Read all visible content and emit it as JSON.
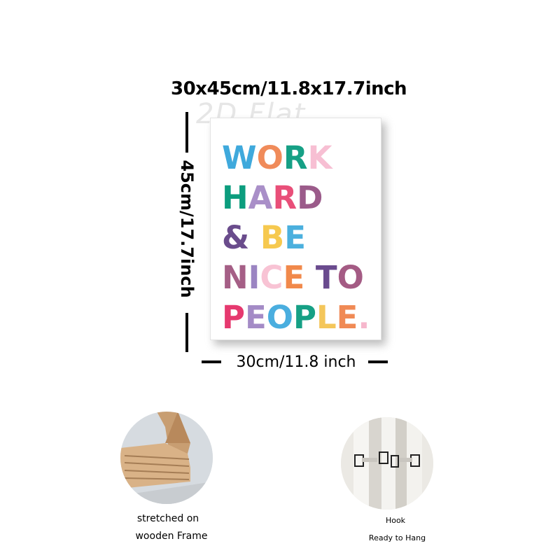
{
  "dimensions": {
    "top_label": "30x45cm/11.8x17.7inch",
    "left_label": "45cm/17.7inch",
    "bottom_label": "30cm/11.8 inch"
  },
  "watermark": "2D Flat",
  "poster": {
    "lines": [
      [
        {
          "text": "W",
          "color": "#3fa9dc"
        },
        {
          "text": "O",
          "color": "#f08b5a"
        },
        {
          "text": "R",
          "color": "#16a085"
        },
        {
          "text": "K",
          "color": "#f7bfd3"
        }
      ],
      [
        {
          "text": "H",
          "color": "#0c9d7e"
        },
        {
          "text": "A",
          "color": "#a98fc8"
        },
        {
          "text": "R",
          "color": "#e94f79"
        },
        {
          "text": "D",
          "color": "#9b5b8a"
        }
      ],
      [
        {
          "text": "& ",
          "color": "#6a4c8c"
        },
        {
          "text": "B",
          "color": "#f6c94f"
        },
        {
          "text": "E",
          "color": "#4bb0de"
        }
      ],
      [
        {
          "text": "N",
          "color": "#a55f86"
        },
        {
          "text": "I",
          "color": "#9b85c2"
        },
        {
          "text": "C",
          "color": "#f8c3d4"
        },
        {
          "text": "E",
          "color": "#f1894b"
        },
        {
          "text": " T",
          "color": "#6a4b8e"
        },
        {
          "text": "O",
          "color": "#a45b84"
        }
      ],
      [
        {
          "text": "P",
          "color": "#e6396f"
        },
        {
          "text": "E",
          "color": "#a48bc6"
        },
        {
          "text": "O",
          "color": "#4aaedf"
        },
        {
          "text": "P",
          "color": "#16a085"
        },
        {
          "text": "L",
          "color": "#f4c65a"
        },
        {
          "text": "E",
          "color": "#f08a55"
        },
        {
          "text": ".",
          "color": "#f6b7cc"
        }
      ]
    ]
  },
  "features": {
    "frame": {
      "line1": "stretched on",
      "line2": "wooden Frame"
    },
    "hook": {
      "line1": "Hook",
      "line2": "Ready to Hang"
    }
  }
}
